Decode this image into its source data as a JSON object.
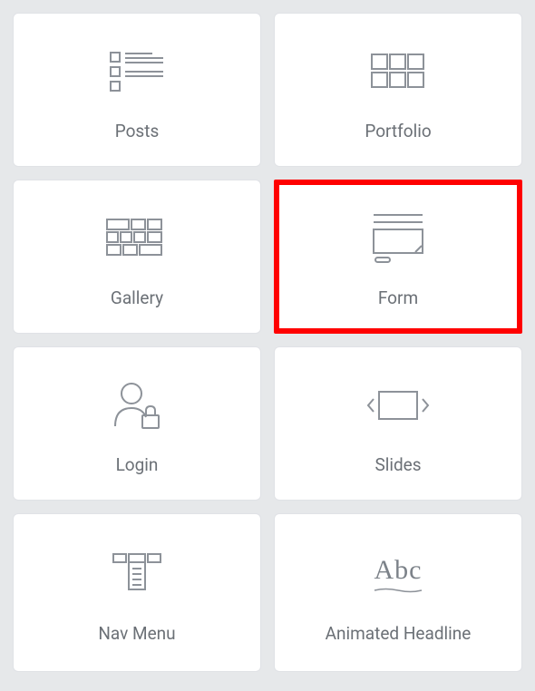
{
  "tiles": [
    {
      "label": "Posts",
      "icon": "posts-icon",
      "highlighted": false
    },
    {
      "label": "Portfolio",
      "icon": "portfolio-icon",
      "highlighted": false
    },
    {
      "label": "Gallery",
      "icon": "gallery-icon",
      "highlighted": false
    },
    {
      "label": "Form",
      "icon": "form-icon",
      "highlighted": true
    },
    {
      "label": "Login",
      "icon": "login-icon",
      "highlighted": false
    },
    {
      "label": "Slides",
      "icon": "slides-icon",
      "highlighted": false
    },
    {
      "label": "Nav Menu",
      "icon": "nav-menu-icon",
      "highlighted": false
    },
    {
      "label": "Animated Headline",
      "icon": "animated-headline-icon",
      "highlighted": false
    }
  ],
  "colors": {
    "highlight": "#ff0000",
    "background": "#e6e8ea",
    "tile": "#ffffff",
    "icon": "#8d9299",
    "text": "#6b7076"
  }
}
